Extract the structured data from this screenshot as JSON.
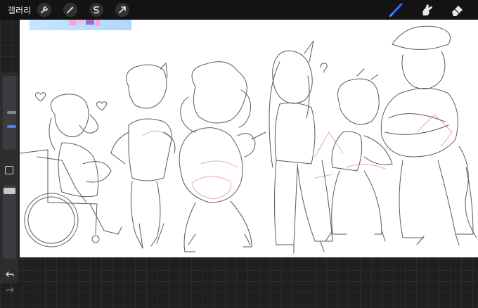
{
  "topbar": {
    "gallery_label": "갤러리",
    "left_tools": [
      {
        "icon": "wrench-icon"
      },
      {
        "icon": "magic-wand-icon"
      },
      {
        "icon": "selection-s-icon"
      },
      {
        "icon": "transform-arrow-icon"
      }
    ],
    "right_tools": [
      {
        "icon": "brush-icon",
        "active": true
      },
      {
        "icon": "smudge-icon",
        "active": false
      },
      {
        "icon": "eraser-icon",
        "active": false
      }
    ],
    "accent_color": "#2f6bff"
  },
  "sidebar": {
    "brush_size_slider": {
      "level": 0.55
    },
    "opacity_slider": {
      "level": 1.0
    },
    "modify_button": {
      "icon": "square-modify-icon"
    },
    "undo": {
      "icon": "undo-icon"
    },
    "redo": {
      "icon": "redo-icon",
      "enabled": false
    }
  },
  "canvas": {
    "background": "#ffffff",
    "reference_image": {
      "colors": [
        "#c6e6ff",
        "#ff9fd2",
        "#9b6bd6"
      ]
    },
    "sketch": {
      "line_color": "#555555",
      "guide_color": "#e8a49c",
      "figure_count": 7
    }
  }
}
